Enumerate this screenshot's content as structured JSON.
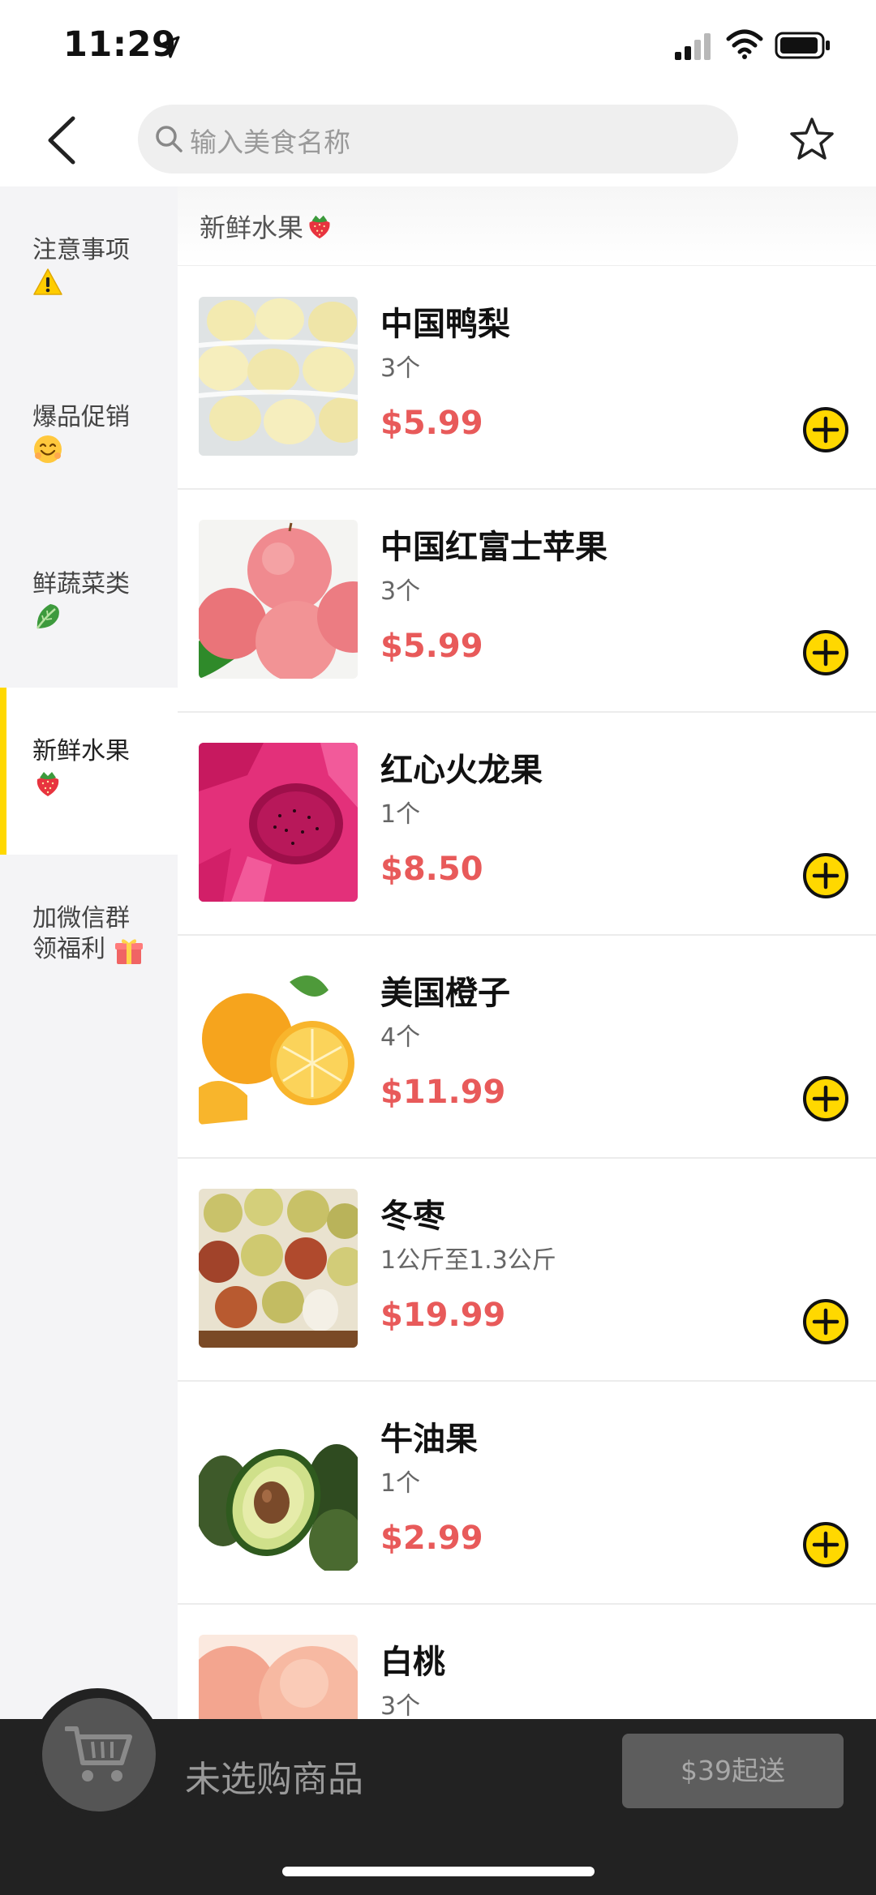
{
  "status_bar": {
    "time": "11:29"
  },
  "search": {
    "placeholder": "输入美食名称"
  },
  "sidebar": {
    "items": [
      {
        "label": "注意事项",
        "emoji": "warning"
      },
      {
        "label": "爆品促销",
        "emoji": "smile"
      },
      {
        "label": "鲜蔬菜类",
        "emoji": "leafy-green"
      },
      {
        "label": "新鲜水果",
        "emoji": "strawberry",
        "active": true
      },
      {
        "label": "加微信群",
        "label2": "领福利",
        "emoji": "gift"
      }
    ]
  },
  "content_header": {
    "title": "新鲜水果",
    "emoji": "strawberry"
  },
  "products": [
    {
      "name": "中国鸭梨",
      "qty": "3个",
      "price": "$5.99",
      "image": "pears"
    },
    {
      "name": "中国红富士苹果",
      "qty": "3个",
      "price": "$5.99",
      "image": "apples"
    },
    {
      "name": "红心火龙果",
      "qty": "1个",
      "price": "$8.50",
      "image": "dragonfruit"
    },
    {
      "name": "美国橙子",
      "qty": "4个",
      "price": "$11.99",
      "image": "oranges"
    },
    {
      "name": "冬枣",
      "qty": "1公斤至1.3公斤",
      "price": "$19.99",
      "image": "jujubes"
    },
    {
      "name": "牛油果",
      "qty": "1个",
      "price": "$2.99",
      "image": "avocado"
    },
    {
      "name": "白桃",
      "qty": "3个",
      "price": "",
      "image": "peach"
    }
  ],
  "cart": {
    "status": "未选购商品",
    "checkout_label": "$39起送"
  },
  "colors": {
    "accent": "#ffd800",
    "price": "#e85a5a",
    "cart_bar": "#222222"
  }
}
